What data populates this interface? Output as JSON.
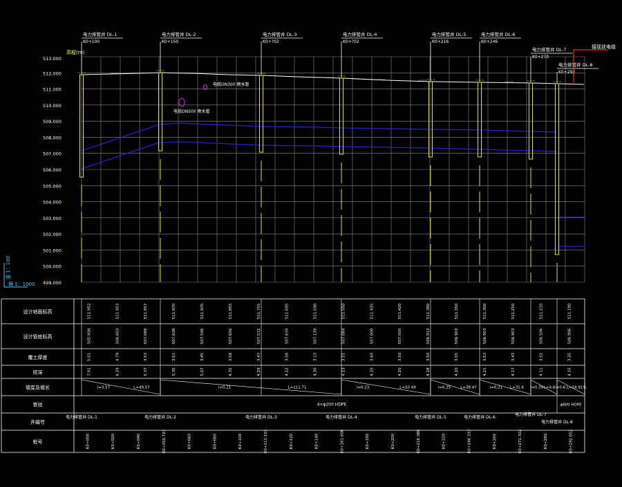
{
  "axis": {
    "unit_label": "高程(m)",
    "y_labels": [
      "513.000",
      "512.000",
      "511.000",
      "510.000",
      "509.000",
      "508.000",
      "507.000",
      "506.000",
      "505.000",
      "504.000",
      "503.000",
      "502.000",
      "501.000",
      "500.000",
      "499.000"
    ]
  },
  "scale": {
    "vertical": "竖 1：100",
    "horizontal": "横 1：1000"
  },
  "wells": [
    {
      "label": "电力排管井 DL-1",
      "station": "K0+100"
    },
    {
      "label": "电力排管井 DL-2",
      "station": "K0+150"
    },
    {
      "label": "电力排管井 DL-3",
      "station": "K0+?02"
    },
    {
      "label": "电力排管井 DL-4",
      "station": "K0+?02"
    },
    {
      "label": "电力排管井 DL-5",
      "station": "K0+216"
    },
    {
      "label": "电力排管井 DL-6",
      "station": "K0+246"
    },
    {
      "label": "电力排管井 DL-7",
      "station": "K0+270"
    },
    {
      "label": "电力排管井 DL-8",
      "station": "K0+292"
    }
  ],
  "callout_red": "接现状电缆",
  "annotations": {
    "pipe1": "电缆DN300 雨水管",
    "pipe2": "电缆DN500 雨水管"
  },
  "table": {
    "row_labels": [
      "设计地面标高",
      "设计管底标高",
      "覆土厚度",
      "挖深",
      "坡度及坡长",
      "管径",
      "井编号",
      "桩号"
    ],
    "row1": [
      "511.952",
      "511.953",
      "511.957",
      "511.970",
      "511.935",
      "511.855",
      "511.755",
      "511.695",
      "511.590",
      "511.550",
      "511.435",
      "511.420",
      "511.380",
      "511.350",
      "511.300",
      "511.250",
      "511.210",
      "511.190"
    ],
    "row2": [
      "505.938",
      "506.603",
      "507.088",
      "507.638",
      "507.506",
      "507.656",
      "507.512",
      "507.634",
      "507.139",
      "507.084",
      "507.000",
      "507.000",
      "506.913",
      "506.903",
      "506.903",
      "506.903",
      "506.506",
      "506.906"
    ],
    "row3": [
      "5.01",
      "4.79",
      "3.53",
      "3.51",
      "3.45",
      "3.58",
      "3.47",
      "3.56",
      "3.13",
      "3.51",
      "3.60",
      "3.50",
      "3.50",
      "3.55",
      "3.53",
      "3.43",
      "3.52",
      "3.25"
    ],
    "row4": [
      "7.01",
      "6.29",
      "5.37",
      "5.35",
      "5.27",
      "4.31",
      "4.29",
      "4.22",
      "4.30",
      "4.23",
      "4.25",
      "4.20",
      "4.18",
      "4.20",
      "4.21",
      "4.17",
      "4.11",
      "4.15"
    ],
    "slopes": [
      "i=3.57",
      "L=49.57",
      "i=0.21",
      "L=111.71",
      "i=0.23",
      "L=50.49",
      "i=0.25",
      "L=38.47",
      "i=0.21",
      "L=31.6",
      "i=0.39",
      "L=4.6",
      "i=0.6 L=18.91%"
    ],
    "pipe": "4×φ200 HDPE",
    "pipe2": "φ800 HDPE",
    "row8": [
      "K0+000",
      "K0+020",
      "K0+040",
      "K0+050.727",
      "K0+060",
      "K0+080",
      "K0+100",
      "K0+111.101",
      "K0+120",
      "K0+140",
      "K0+161.606",
      "K0+180",
      "K0+200",
      "K0+216.388",
      "K0+220",
      "K0+246.333",
      "K0+260",
      "K0+271.322",
      "K0+280",
      "K0+292.052"
    ]
  }
}
